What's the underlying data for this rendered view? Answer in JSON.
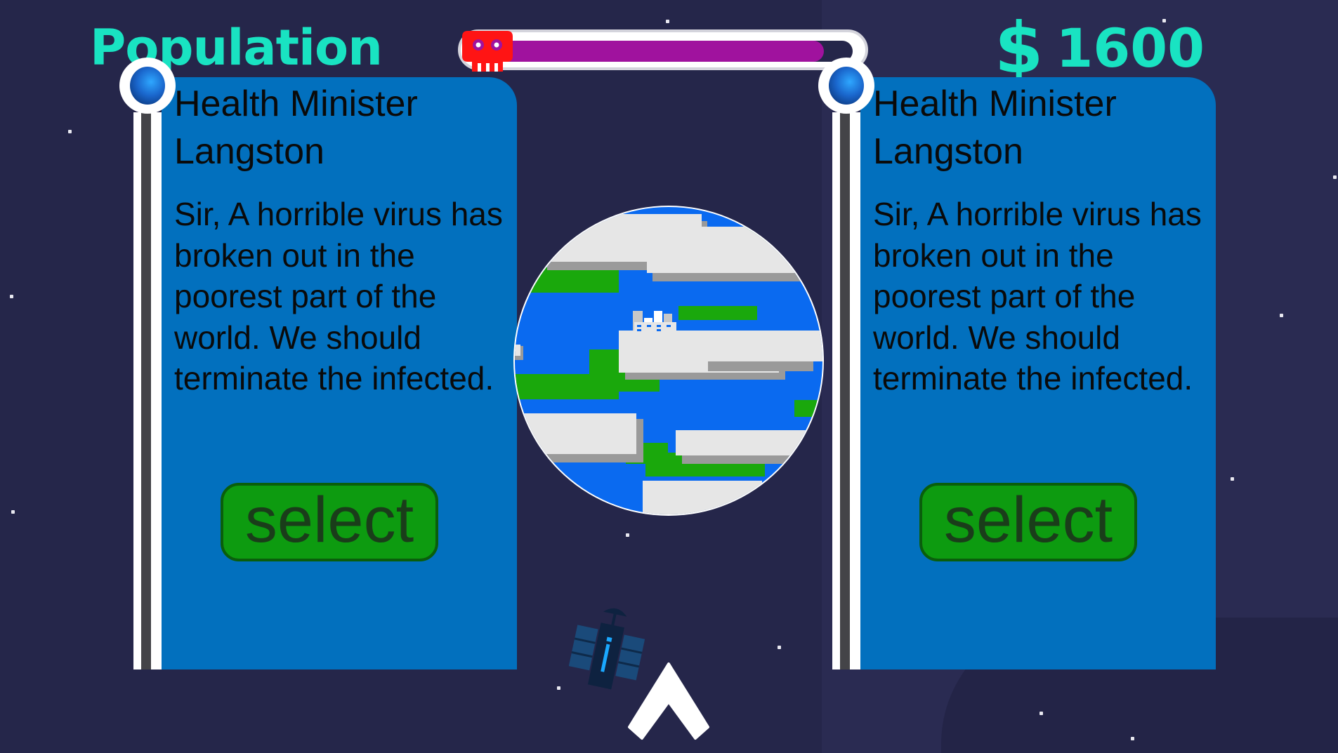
{
  "hud": {
    "population_label": "Population",
    "population_level": 0.92,
    "currency_symbol": "$",
    "money": "1600"
  },
  "cards": [
    {
      "title": "Health Minister Langston",
      "text": "Sir, A horrible virus has broken out in the poorest part of the world. We should terminate the infected.",
      "button": "select"
    },
    {
      "title": "Health Minister Langston",
      "text": "Sir, A horrible virus has broken out in the poorest part of the world. We should terminate the infected.",
      "button": "select"
    }
  ],
  "colors": {
    "background": "#25264a",
    "hud_text": "#19e3c2",
    "card_panel": "#0270be",
    "button_fill": "#0d9b10",
    "population_bar": "#a0129e",
    "skull": "#ff1414"
  },
  "icons": [
    "skull-icon",
    "dollar-icon",
    "planet-earth-icon",
    "satellite-icon",
    "up-arrow-icon",
    "gem-knob-icon"
  ]
}
